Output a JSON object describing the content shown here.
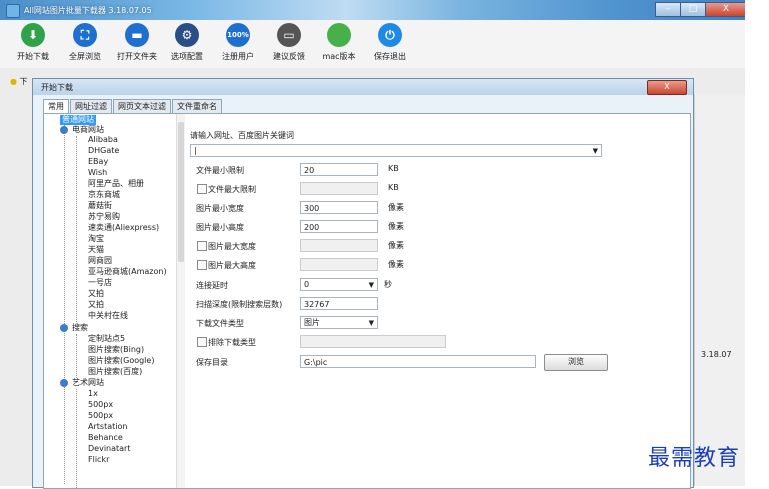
{
  "window": {
    "title": "All网站图片批量下载器 3.18.07.05",
    "minimize": "–",
    "maximize": "□",
    "close": "X"
  },
  "toolbar": [
    {
      "label": "开始下载",
      "glyph": "⬇",
      "icon": "download-icon",
      "color": "#2fa24a"
    },
    {
      "label": "全屏浏览",
      "glyph": "⛶",
      "icon": "fullscreen-icon",
      "color": "#1f6fd0"
    },
    {
      "label": "打开文件夹",
      "glyph": "▬",
      "icon": "folder-icon",
      "color": "#1f6fd0"
    },
    {
      "label": "选项配置",
      "glyph": "⚙",
      "icon": "gear-icon",
      "color": "#2a4f86"
    },
    {
      "label": "注册用户",
      "glyph": "100%",
      "icon": "register-icon",
      "color": "#1f6fd0"
    },
    {
      "label": "建议反馈",
      "glyph": "▭",
      "icon": "feedback-icon",
      "color": "#555555"
    },
    {
      "label": "mac版本",
      "glyph": "",
      "icon": "apple-icon",
      "color": "#47b04b"
    },
    {
      "label": "保存退出",
      "glyph": "⏻",
      "icon": "power-icon",
      "color": "#1f8ae6"
    }
  ],
  "background": {
    "tab_label": "下",
    "version_label": "3.18.07"
  },
  "dialog": {
    "title": "开始下载",
    "close": "X",
    "tabs": [
      "常用",
      "网址过滤",
      "网页文本过滤",
      "文件重命名"
    ],
    "tree": {
      "root": "普通网站",
      "groups": [
        {
          "name": "电商网站",
          "items": [
            "Alibaba",
            "DHGate",
            "EBay",
            "Wish",
            "阿里产品、相册",
            "京东商城",
            "蘑菇街",
            "苏宁易购",
            "速卖通(Aliexpress)",
            "淘宝",
            "天猫",
            "网商园",
            "亚马逊商城(Amazon)",
            "一号店",
            "又拍",
            "又拍",
            "中关村在线"
          ]
        },
        {
          "name": "搜索",
          "items": [
            "定制站点5",
            "图片搜索(Bing)",
            "图片搜索(Google)",
            "图片搜索(百度)"
          ]
        },
        {
          "name": "艺术网站",
          "items": [
            "1x",
            "500px",
            "500px",
            "Artstation",
            "Behance",
            "Devinatart",
            "Flickr"
          ]
        }
      ]
    },
    "form": {
      "url_label": "请输入网址、百度图片关键词",
      "url_value": "|",
      "min_size_label": "文件最小限制",
      "min_size_value": "20",
      "min_size_unit": "KB",
      "max_size_label": "文件最大限制",
      "max_size_unit": "KB",
      "min_width_label": "图片最小宽度",
      "min_width_value": "300",
      "min_width_unit": "像素",
      "min_height_label": "图片最小高度",
      "min_height_value": "200",
      "min_height_unit": "像素",
      "max_width_label": "图片最大宽度",
      "max_width_unit": "像素",
      "max_height_label": "图片最大高度",
      "max_height_unit": "像素",
      "delay_label": "连接延时",
      "delay_value": "0",
      "delay_unit": "秒",
      "depth_label": "扫描深度(限制搜索层数)",
      "depth_value": "32767",
      "filetype_label": "下载文件类型",
      "filetype_value": "图片",
      "exclude_label": "排除下载类型",
      "savedir_label": "保存目录",
      "savedir_value": "G:\\pic",
      "browse_label": "浏览"
    }
  },
  "watermark": "最需教育"
}
